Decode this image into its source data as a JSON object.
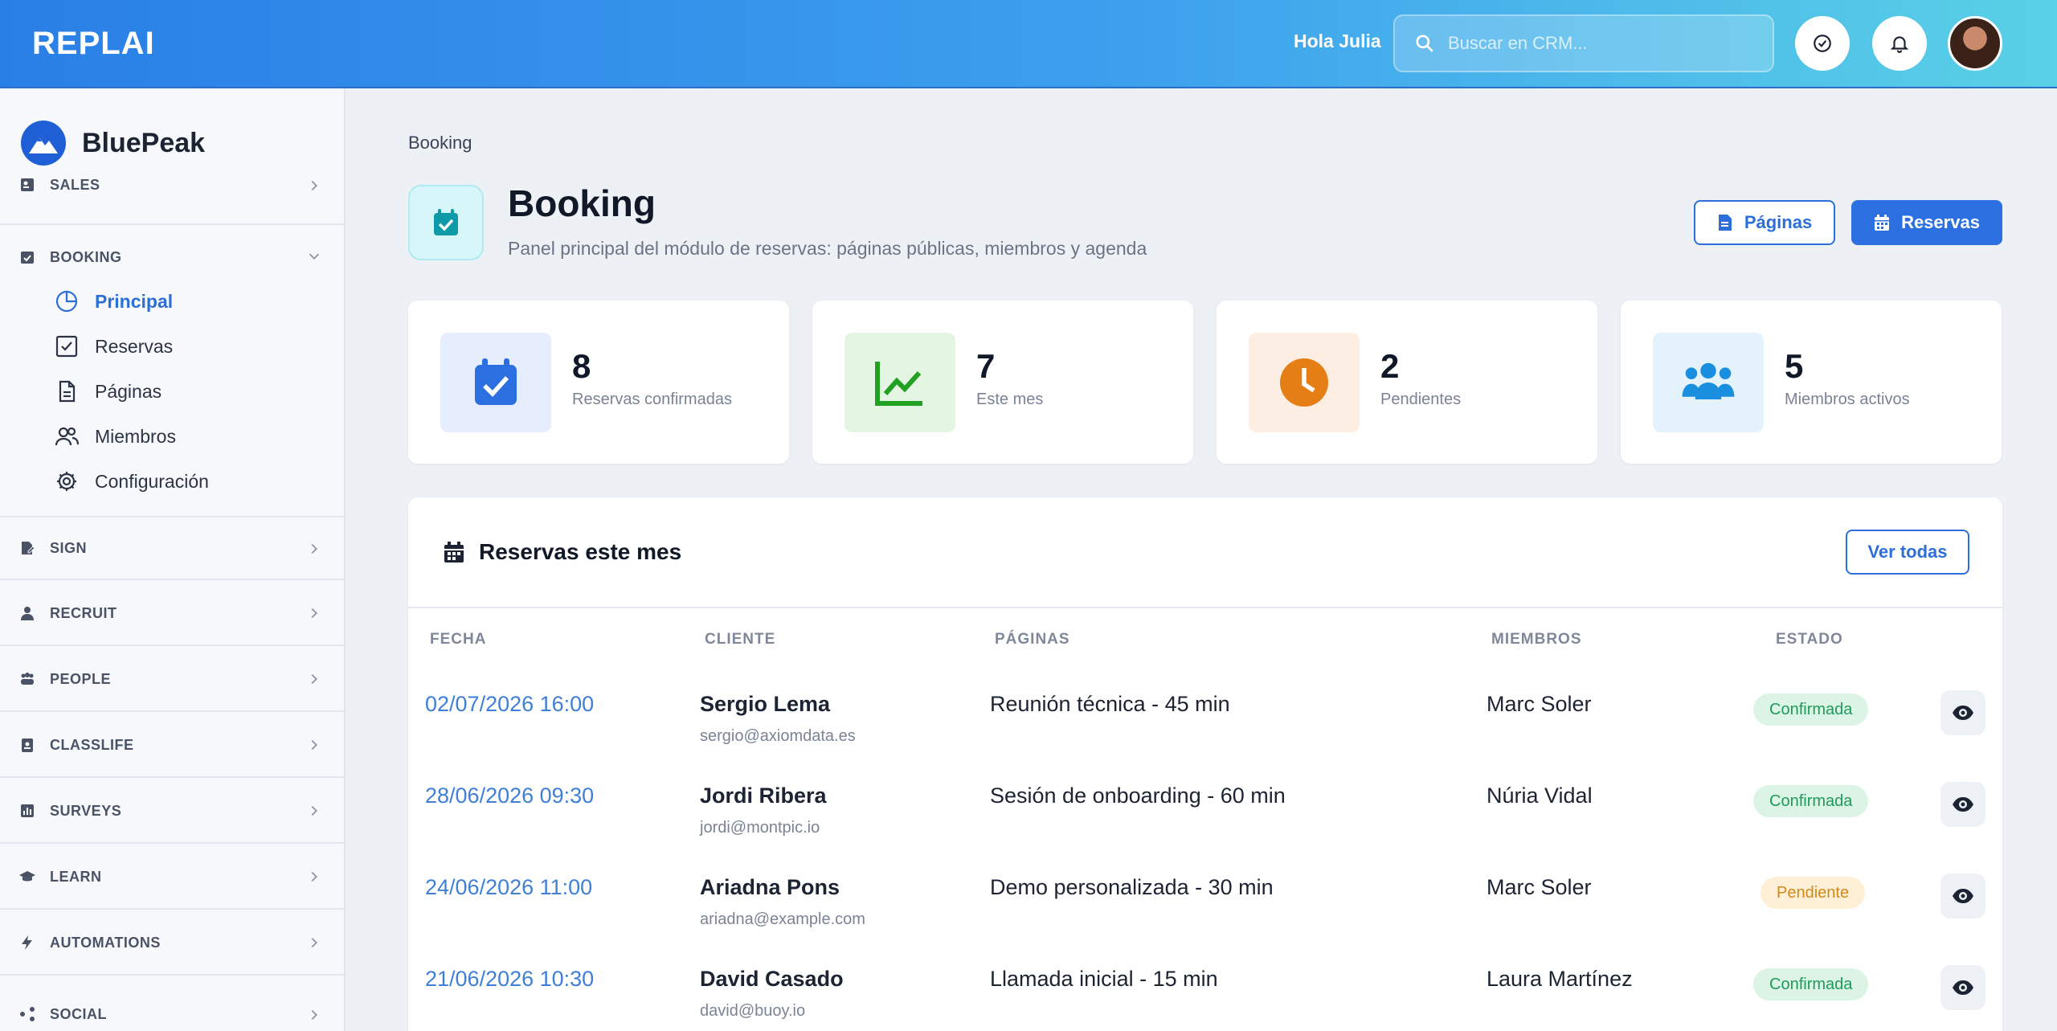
{
  "app": {
    "logo": "REPLAI",
    "greeting": "Hola Julia",
    "search_placeholder": "Buscar en CRM..."
  },
  "sidebar": {
    "brand": "BluePeak",
    "sections": {
      "sales": "SALES",
      "booking": "BOOKING",
      "sign": "SIGN",
      "recruit": "RECRUIT",
      "people": "PEOPLE",
      "classlife": "CLASSLIFE",
      "surveys": "SURVEYS",
      "learn": "LEARN",
      "automations": "AUTOMATIONS",
      "social": "SOCIAL"
    },
    "booking_items": [
      "Principal",
      "Reservas",
      "Páginas",
      "Miembros",
      "Configuración"
    ]
  },
  "page": {
    "breadcrumb": "Booking",
    "title": "Booking",
    "subtitle": "Panel principal del módulo de reservas: páginas públicas, miembros y agenda",
    "btn_pages": "Páginas",
    "btn_bookings": "Reservas"
  },
  "stats": [
    {
      "value": "8",
      "label": "Reservas confirmadas"
    },
    {
      "value": "7",
      "label": "Este mes"
    },
    {
      "value": "2",
      "label": "Pendientes"
    },
    {
      "value": "5",
      "label": "Miembros activos"
    }
  ],
  "panel": {
    "title": "Reservas este mes",
    "view_all": "Ver todas",
    "columns": [
      "FECHA",
      "CLIENTE",
      "PÁGINAS",
      "MIEMBROS",
      "ESTADO"
    ],
    "rows": [
      {
        "date": "02/07/2026 16:00",
        "client": "Sergio Lema",
        "email": "sergio@axiomdata.es",
        "page": "Reunión técnica - 45 min",
        "member": "Marc Soler",
        "status": "Confirmada"
      },
      {
        "date": "28/06/2026 09:30",
        "client": "Jordi Ribera",
        "email": "jordi@montpic.io",
        "page": "Sesión de onboarding - 60 min",
        "member": "Núria Vidal",
        "status": "Confirmada"
      },
      {
        "date": "24/06/2026 11:00",
        "client": "Ariadna Pons",
        "email": "ariadna@example.com",
        "page": "Demo personalizada - 30 min",
        "member": "Marc Soler",
        "status": "Pendiente"
      },
      {
        "date": "21/06/2026 10:30",
        "client": "David Casado",
        "email": "david@buoy.io",
        "page": "Llamada inicial - 15 min",
        "member": "Laura Martínez",
        "status": "Confirmada"
      }
    ]
  },
  "colors": {
    "accent": "#2c6fd8",
    "confirmed": "#1f9a5a",
    "pending": "#d2891a"
  }
}
